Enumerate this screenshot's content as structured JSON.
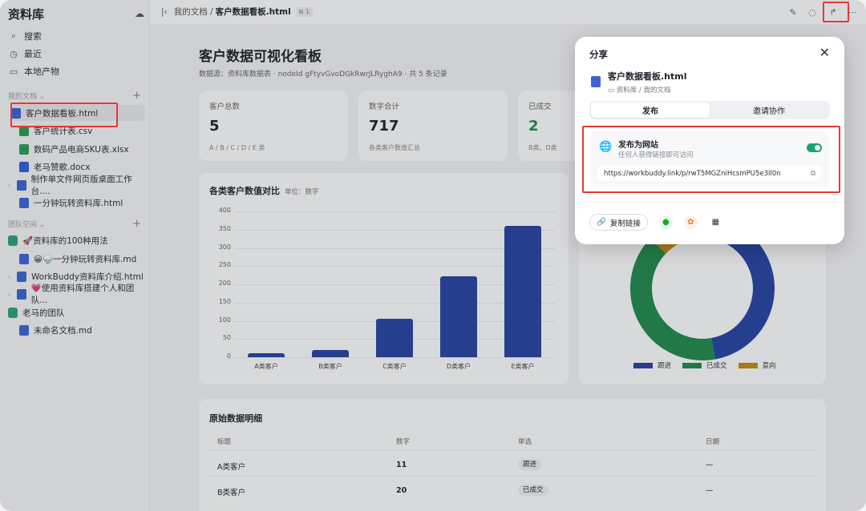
{
  "sidebar": {
    "title": "资料库",
    "nav": [
      {
        "label": "搜索"
      },
      {
        "label": "最近"
      },
      {
        "label": "本地产物"
      }
    ],
    "my_docs_section": "我的文档",
    "my_docs": [
      {
        "label": "客户数据看板.html",
        "type": "html"
      },
      {
        "label": "客户统计表.csv",
        "type": "csv"
      },
      {
        "label": "数码产品电商SKU表.xlsx",
        "type": "xlsx"
      },
      {
        "label": "老马赞歌.docx",
        "type": "docx"
      },
      {
        "label": "制作单文件网页版桌面工作台....",
        "type": "html"
      },
      {
        "label": "一分钟玩转资料库.html",
        "type": "html"
      }
    ],
    "team_section": "团队空间",
    "team": [
      {
        "label": "🚀资料库的100种用法",
        "type": "team"
      },
      {
        "label": "😀🍚一分钟玩转资料库.md",
        "type": "md"
      },
      {
        "label": "WorkBuddy资料库介绍.html",
        "type": "html"
      },
      {
        "label": "💗使用资料库搭建个人和团队...",
        "type": "html"
      },
      {
        "label": "老马的团队",
        "type": "team"
      },
      {
        "label": "未命名文档.md",
        "type": "md"
      }
    ]
  },
  "topbar": {
    "crumb_root": "我的文档 /",
    "crumb_current": "客户数据看板.html",
    "count": "1"
  },
  "main": {
    "title": "客户数据可视化看板",
    "subtitle": "数据源：资料库数据表 · nodeId gFtyvGvoDGkRwrJLRyghA9 · 共 5 条记录",
    "kpis": [
      {
        "label": "客户总数",
        "value": "5",
        "sub": "A / B / C / D / E 类"
      },
      {
        "label": "数字合计",
        "value": "717",
        "sub": "各类客户数值汇总"
      },
      {
        "label": "已成交",
        "value": "2",
        "sub": "B类、D类"
      }
    ],
    "bar_chart_title": "各类客户数值对比",
    "bar_chart_unit": "单位：数字",
    "legend": [
      {
        "label": "跟进",
        "color": "#2643a3"
      },
      {
        "label": "已成交",
        "color": "#1f8a4c"
      },
      {
        "label": "意向",
        "color": "#c98a0f"
      }
    ],
    "table": {
      "title": "原始数据明细",
      "headers": [
        "标题",
        "数字",
        "单选",
        "日期"
      ],
      "rows": [
        {
          "title": "A类客户",
          "num": "11",
          "status": "跟进",
          "date": "—"
        },
        {
          "title": "B类客户",
          "num": "20",
          "status": "已成交",
          "date": "—"
        }
      ]
    }
  },
  "chart_data": [
    {
      "type": "bar",
      "title": "各类客户数值对比",
      "ylabel": "单位：数字",
      "categories": [
        "A类客户",
        "B类客户",
        "C类客户",
        "D类客户",
        "E类客户"
      ],
      "values": [
        11,
        20,
        105,
        221,
        360
      ],
      "ylim": [
        0,
        400
      ],
      "yticks": [
        0,
        50,
        100,
        150,
        200,
        250,
        300,
        350,
        400
      ],
      "grid": true
    },
    {
      "type": "pie",
      "subtype": "donut",
      "labels": [
        "跟进",
        "已成交",
        "意向"
      ],
      "values": [
        2,
        2,
        1
      ],
      "colors": [
        "#2643a3",
        "#1f8a4c",
        "#c98a0f"
      ],
      "legend": "bottom"
    }
  ],
  "share_modal": {
    "title": "分享",
    "file_name": "客户数据看板.html",
    "file_path": "资料库 / 我的文档",
    "tabs": [
      "发布",
      "邀请协作"
    ],
    "publish_title": "发布为网站",
    "publish_desc": "任何人获得链接即可访问",
    "publish_enabled": true,
    "url": "https://workbuddy.link/p/rwT5MGZniHcsmPU5e3Il0n",
    "copy_link": "复制链接"
  }
}
